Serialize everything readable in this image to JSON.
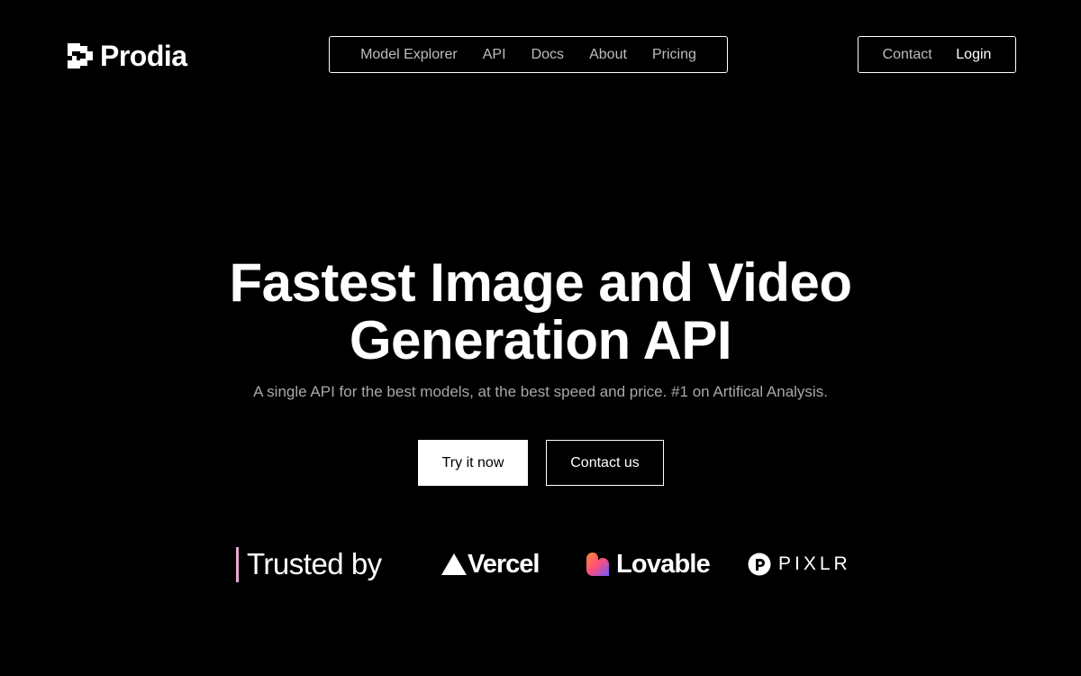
{
  "header": {
    "logo": {
      "text": "Prodia",
      "icon": "prodia-logo-icon"
    },
    "nav_main": [
      {
        "label": "Model Explorer"
      },
      {
        "label": "API"
      },
      {
        "label": "Docs"
      },
      {
        "label": "About"
      },
      {
        "label": "Pricing"
      }
    ],
    "nav_side": {
      "contact_label": "Contact",
      "login_label": "Login"
    }
  },
  "hero": {
    "title_line1": "Fastest Image and Video",
    "title_line2": "Generation API",
    "subtitle": "A single API for the best models, at the best speed and price. #1 on Artifical Analysis.",
    "primary_button": "Try it now",
    "secondary_button": "Contact us"
  },
  "trusted": {
    "label": "Trusted by",
    "accent_color": "#e6a8d0",
    "brands": [
      {
        "name": "Vercel",
        "icon": "vercel-triangle-icon"
      },
      {
        "name": "Lovable",
        "icon": "lovable-heart-icon"
      },
      {
        "name": "PIXLR",
        "icon": "pixlr-icon"
      }
    ]
  },
  "colors": {
    "background": "#000000",
    "text": "#ffffff",
    "muted": "#bdbdbd"
  }
}
